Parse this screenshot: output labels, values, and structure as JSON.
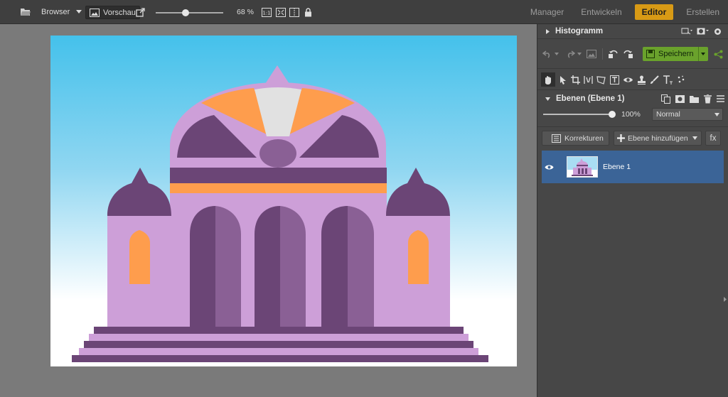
{
  "toolbar": {
    "browser_label": "Browser",
    "preview_label": "Vorschau",
    "zoom_value": "68 %",
    "zoom_slider_fraction": 0.44
  },
  "modes": [
    "Manager",
    "Entwickeln",
    "Editor",
    "Erstellen"
  ],
  "active_mode": "Editor",
  "panel": {
    "histogram_title": "Histogramm",
    "save_label": "Speichern",
    "layers_title": "Ebenen (Ebene 1)",
    "opacity_value": "100%",
    "blend_mode": "Normal",
    "corrections_label": "Korrekturen",
    "add_layer_label": "Ebene hinzufügen",
    "fx_label": "fx",
    "layers": [
      {
        "name": "Ebene 1",
        "visible": true,
        "selected": true
      }
    ]
  },
  "colors": {
    "accent": "#d89a15",
    "save_green": "#6aa22c",
    "layer_selected": "#3b6497"
  }
}
